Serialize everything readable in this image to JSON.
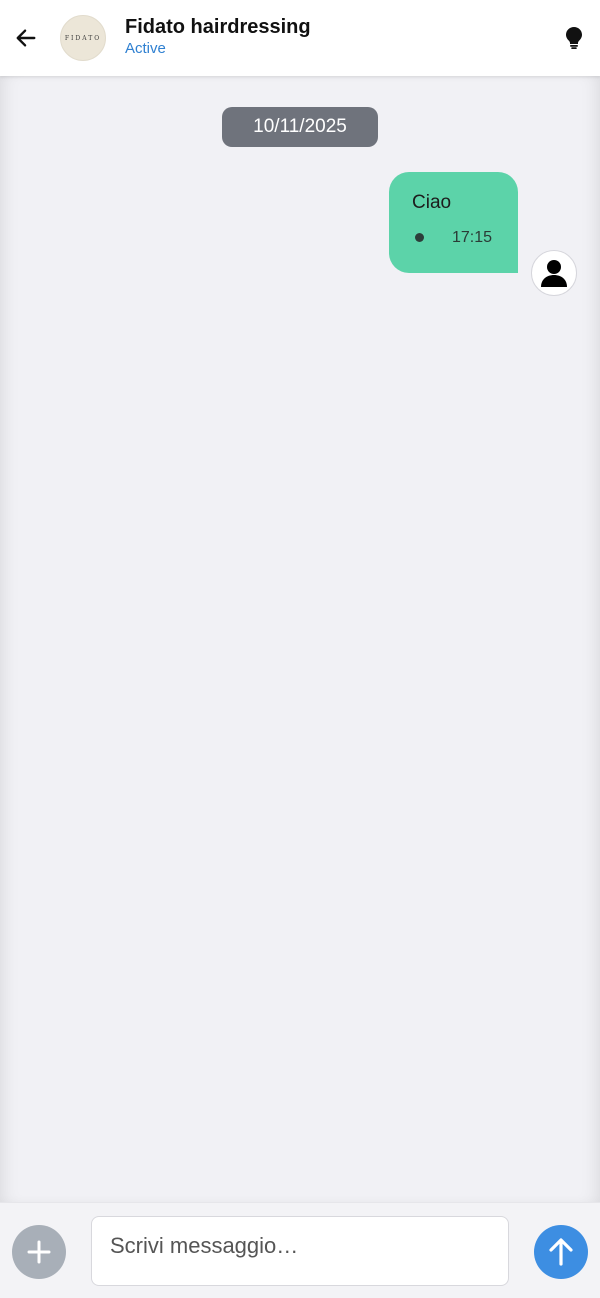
{
  "header": {
    "contact_name": "Fidato hairdressing",
    "status": "Active",
    "logo_text": "FIDATO",
    "back_icon": "arrow-left-icon",
    "tip_icon": "lightbulb-icon"
  },
  "chat": {
    "date_separator": "10/11/2025",
    "messages": [
      {
        "text": "Ciao",
        "time": "17:15",
        "direction": "outgoing",
        "status_icon": "dot-icon"
      }
    ]
  },
  "composer": {
    "placeholder": "Scrivi messaggio…",
    "value": "",
    "attach_icon": "plus-icon",
    "send_icon": "arrow-up-icon"
  },
  "colors": {
    "accent_blue": "#3d8ee2",
    "status_blue": "#2f80d1",
    "bubble_green": "#5cd3a9",
    "date_pill": "#6f737c",
    "chat_background": "#f1f1f5",
    "attach_button": "#a8afb8"
  }
}
